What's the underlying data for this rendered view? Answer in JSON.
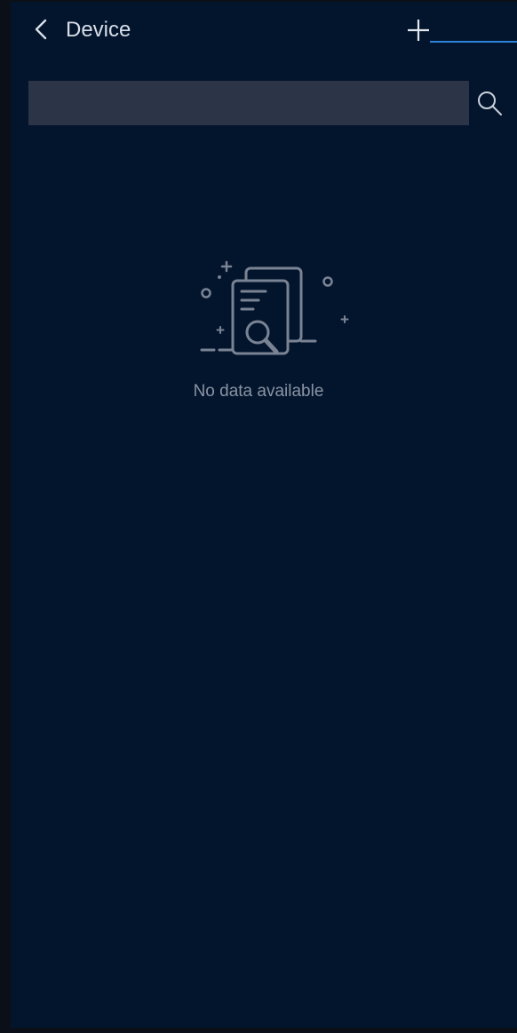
{
  "header": {
    "title": "Device",
    "back_icon": "chevron-left-icon",
    "add_icon": "plus-icon",
    "accent_color": "#2c82d6"
  },
  "search": {
    "value": "",
    "placeholder": "",
    "icon": "search-icon"
  },
  "empty_state": {
    "icon": "documents-search-illustration",
    "message": "No data available"
  },
  "colors": {
    "background": "#03152d",
    "search_field": "#2c3448",
    "muted_text": "#8a93a3"
  }
}
